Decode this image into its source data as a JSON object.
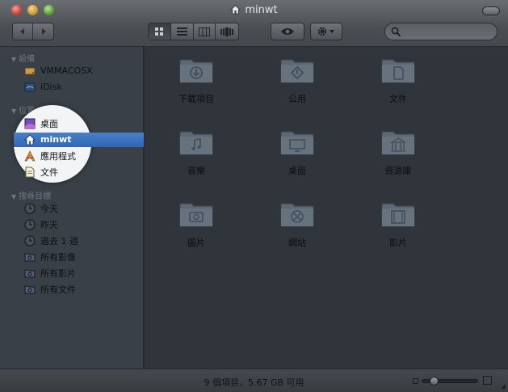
{
  "window": {
    "title": "minwt"
  },
  "sidebar": {
    "sections": [
      {
        "heading": "設備"
      },
      {
        "heading": "位置"
      },
      {
        "heading": "搜尋目標"
      }
    ],
    "devices": [
      {
        "label": "VMMACOSX",
        "icon": "hard-drive-icon"
      },
      {
        "label": "iDisk",
        "icon": "idisk-icon"
      }
    ],
    "places": [
      {
        "label": "桌面",
        "icon": "desktop-icon"
      },
      {
        "label": "minwt",
        "icon": "home-icon",
        "selected": true
      },
      {
        "label": "應用程式",
        "icon": "applications-icon"
      },
      {
        "label": "文件",
        "icon": "documents-icon"
      }
    ],
    "searches": [
      {
        "label": "今天",
        "icon": "clock-icon"
      },
      {
        "label": "昨天",
        "icon": "clock-icon"
      },
      {
        "label": "過去 1 週",
        "icon": "clock-icon"
      },
      {
        "label": "所有影像",
        "icon": "smart-folder-icon"
      },
      {
        "label": "所有影片",
        "icon": "smart-folder-icon"
      },
      {
        "label": "所有文件",
        "icon": "smart-folder-icon"
      }
    ]
  },
  "content": {
    "folders": [
      {
        "label": "下載項目",
        "icon": "downloads-folder-icon"
      },
      {
        "label": "公用",
        "icon": "public-folder-icon"
      },
      {
        "label": "文件",
        "icon": "documents-folder-icon"
      },
      {
        "label": "音樂",
        "icon": "music-folder-icon"
      },
      {
        "label": "桌面",
        "icon": "desktop-folder-icon"
      },
      {
        "label": "資源庫",
        "icon": "library-folder-icon"
      },
      {
        "label": "圖片",
        "icon": "pictures-folder-icon"
      },
      {
        "label": "網站",
        "icon": "sites-folder-icon"
      },
      {
        "label": "影片",
        "icon": "movies-folder-icon"
      }
    ]
  },
  "status": {
    "text": "9 個項目，5.67 GB 可用"
  },
  "colors": {
    "selection": "#2f67b7",
    "folder": "#5d6874",
    "sidebar_bg": "#3a4048"
  }
}
